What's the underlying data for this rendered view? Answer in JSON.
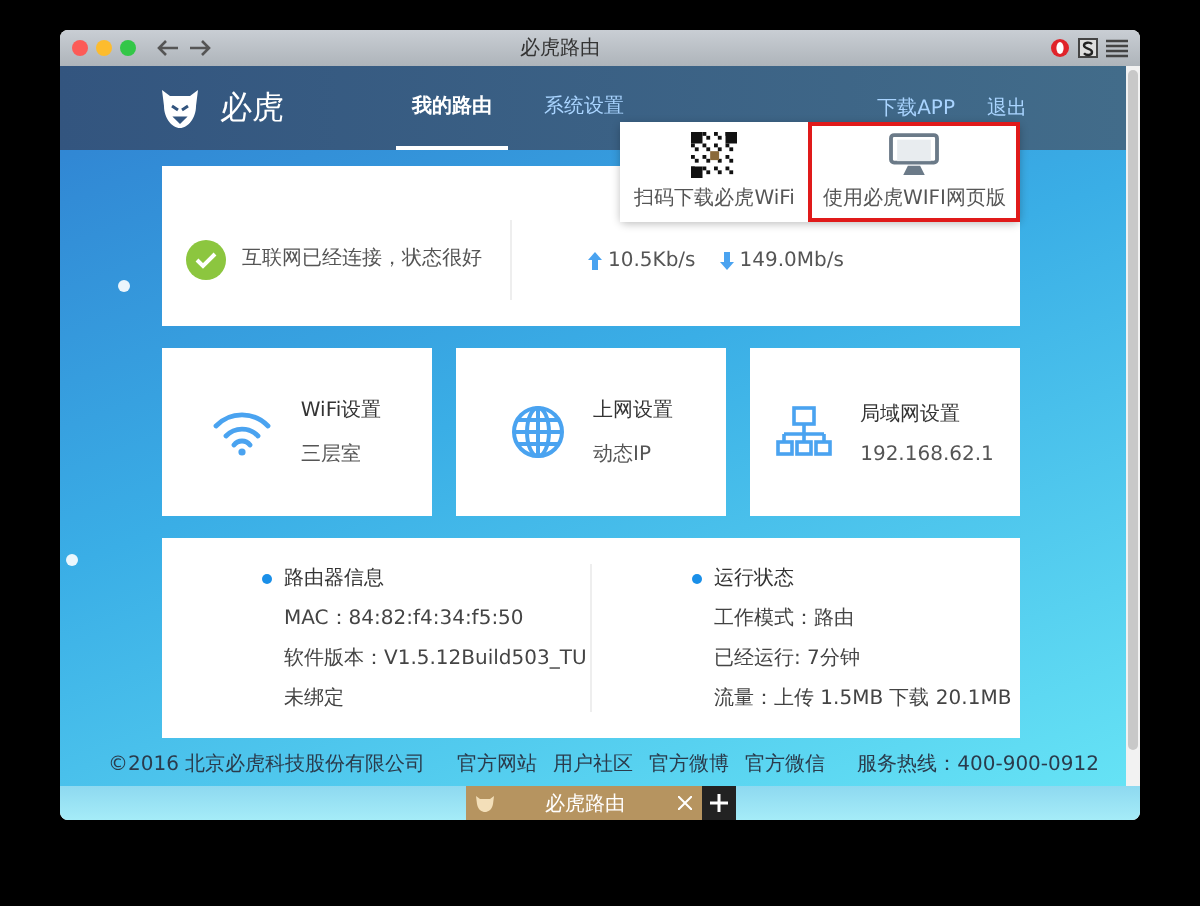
{
  "window": {
    "title": "必虎路由"
  },
  "header": {
    "brand": "必虎",
    "nav": [
      {
        "label": "我的路由",
        "selected": true
      },
      {
        "label": "系统设置",
        "selected": false
      }
    ],
    "links": [
      "下载APP",
      "退出"
    ]
  },
  "download_menu": {
    "items": [
      {
        "kind": "qr",
        "label": "扫码下载必虎WiFi",
        "selected": false
      },
      {
        "kind": "monitor",
        "label": "使用必虎WIFI网页版",
        "selected": true
      }
    ]
  },
  "status": {
    "message": "互联网已经连接，状态很好",
    "upload": "10.5Kb/s",
    "download": "149.0Mb/s"
  },
  "tiles": [
    {
      "kind": "wifi",
      "title": "WiFi设置",
      "value": "三层室"
    },
    {
      "kind": "globe",
      "title": "上网设置",
      "value": "动态IP"
    },
    {
      "kind": "network",
      "title": "局域网设置",
      "value": "192.168.62.1"
    }
  ],
  "info": [
    {
      "title": "路由器信息",
      "lines": [
        "MAC：84:82:f4:34:f5:50",
        "软件版本：V1.5.12Build503_TU",
        "未绑定"
      ]
    },
    {
      "title": "运行状态",
      "lines": [
        "工作模式：路由",
        "已经运行: 7分钟",
        "流量：上传 1.5MB 下载 20.1MB"
      ]
    }
  ],
  "footer": {
    "copyright": "©2016 北京必虎科技股份有限公司",
    "links": [
      "官方网站",
      "用户社区",
      "官方微博",
      "官方微信"
    ],
    "hotline": "服务热线：400-900-0912"
  },
  "tab_bar": {
    "tabs": [
      {
        "label": "必虎路由",
        "selected": true
      }
    ]
  }
}
